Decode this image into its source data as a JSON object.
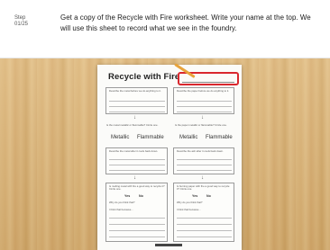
{
  "header": {
    "step_label": "Step",
    "step_count": "01/25",
    "instruction": "Get a copy of the Recycle with Fire worksheet. Write your name at the top. We will use this sheet to record what we see in the foundry."
  },
  "worksheet": {
    "title": "Recycle with Fire",
    "describe_metal_before": "Describe the metal before we do anything to it.",
    "describe_paper_before": "Describe the paper before we do anything to it.",
    "is_metal_question": "Is the metal metallic or flammable? Circle one.",
    "is_paper_question": "Is the paper metallic or flammable? Circle one.",
    "choice_metallic": "Metallic",
    "choice_flammable": "Flammable",
    "describe_metal_after": "Describe the metal after it cools back down.",
    "describe_paper_after": "Describe the ash after it cools back down.",
    "melting_metal_q": "Is melting metal with fire a good way to recycle it? Circle one.",
    "burning_paper_q": "Is burning paper with fire a good way to recycle it? Circle one.",
    "yes": "Yes",
    "no": "No",
    "why_q": "Why do you think that?",
    "think_because": "I think that because..."
  }
}
